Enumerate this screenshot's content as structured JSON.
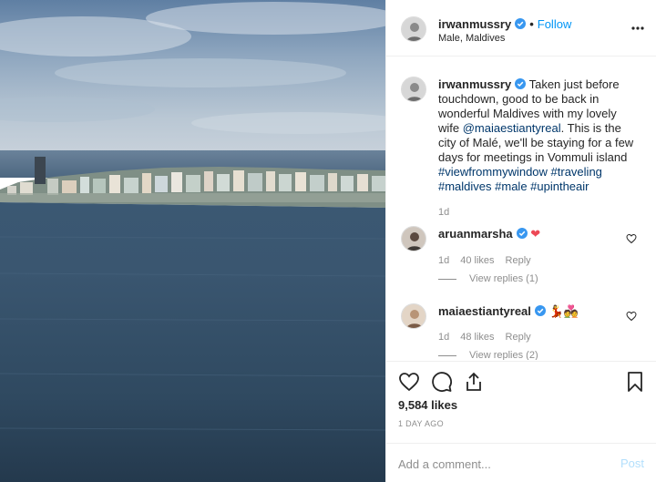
{
  "post": {
    "author": "irwanmussry",
    "follow_label": "Follow",
    "separator": "•",
    "location": "Male, Maldives"
  },
  "caption": {
    "username": "irwanmussry",
    "text_1": "Taken just before touchdown, good to be back in wonderful Maldives with my lovely wife ",
    "mention": "@maiaestiantyreal",
    "text_2": ". This is the city of Malé, we'll be staying for a few days for meetings in Vommuli island ",
    "hashtags_1": "#viewfrommywindow #traveling",
    "hashtags_2": "#maldives #male #upintheair",
    "time": "1d"
  },
  "comments": [
    {
      "username": "aruanmarsha",
      "emoji": "❤",
      "time": "1d",
      "likes": "40 likes",
      "reply_label": "Reply",
      "view_replies": "View replies (1)"
    },
    {
      "username": "maiaestiantyreal",
      "emoji": "💃💑",
      "time": "1d",
      "likes": "48 likes",
      "reply_label": "Reply",
      "view_replies": "View replies (2)"
    }
  ],
  "stats": {
    "likes": "9,584 likes",
    "posted": "1 DAY AGO"
  },
  "comment_box": {
    "placeholder": "Add a comment...",
    "post_label": "Post"
  },
  "icons": {
    "verified": "verified-badge-icon",
    "more": "more-options-icon",
    "like": "heart-icon",
    "comment": "comment-icon",
    "share": "share-icon",
    "save": "bookmark-icon"
  },
  "colors": {
    "accent": "#0095f6",
    "verified": "#3897f0",
    "heart_red": "#ed4956",
    "muted": "#8e8e8e"
  }
}
